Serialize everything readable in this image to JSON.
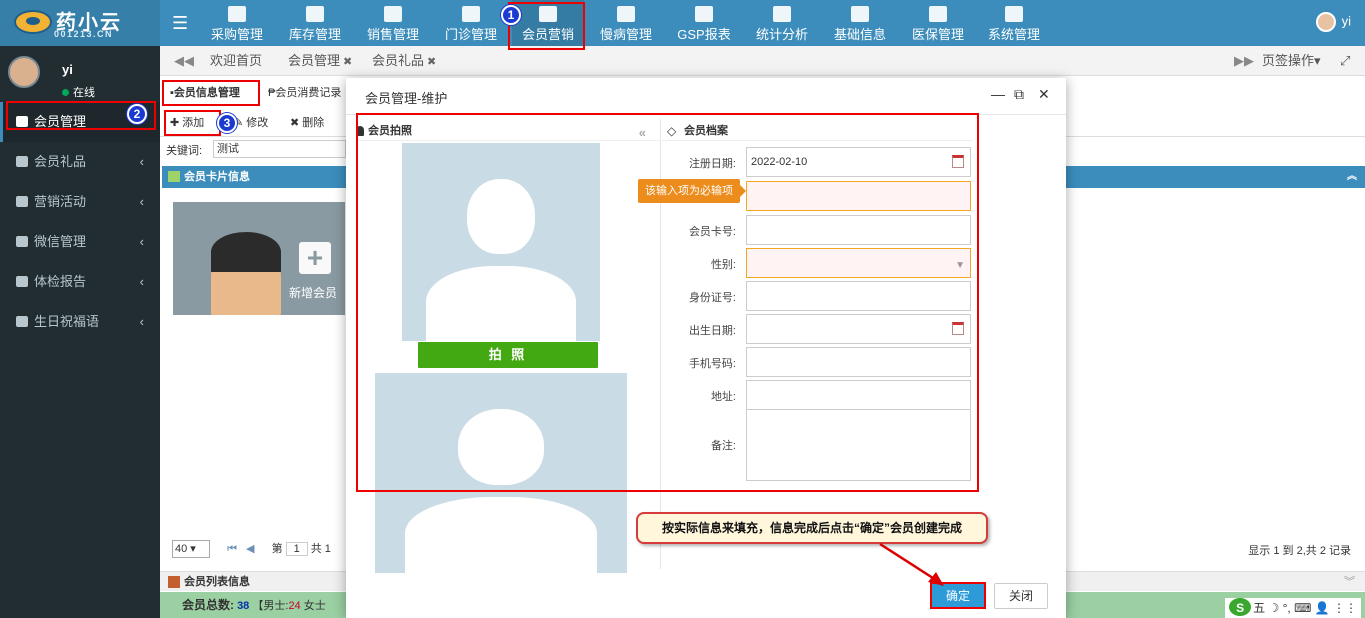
{
  "logo": {
    "main": "药小云",
    "sub": "001213.CN"
  },
  "topnav": [
    {
      "label": "采购管理",
      "icon": "cart-icon"
    },
    {
      "label": "库存管理",
      "icon": "cube-icon"
    },
    {
      "label": "销售管理",
      "icon": "register-icon"
    },
    {
      "label": "门诊管理",
      "icon": "medkit-icon"
    },
    {
      "label": "会员营销",
      "icon": "users-icon"
    },
    {
      "label": "慢病管理",
      "icon": "hospital-icon"
    },
    {
      "label": "GSP报表",
      "icon": "report-icon"
    },
    {
      "label": "统计分析",
      "icon": "chart-icon"
    },
    {
      "label": "基础信息",
      "icon": "book-icon"
    },
    {
      "label": "医保管理",
      "icon": "windows-icon"
    },
    {
      "label": "系统管理",
      "icon": "windows-icon"
    }
  ],
  "user": {
    "name": "yi",
    "status": "在线"
  },
  "sidebar": [
    {
      "label": "会员管理"
    },
    {
      "label": "会员礼品"
    },
    {
      "label": "营销活动"
    },
    {
      "label": "微信管理"
    },
    {
      "label": "体检报告"
    },
    {
      "label": "生日祝福语"
    }
  ],
  "tabs": [
    {
      "label": "欢迎首页"
    },
    {
      "label": "会员管理"
    },
    {
      "label": "会员礼品"
    }
  ],
  "tab_actions": {
    "label": "页签操作▾"
  },
  "subtabs": [
    {
      "label": "会员信息管理"
    },
    {
      "label": "会员消费记录"
    }
  ],
  "toolbar": {
    "add": "添加",
    "edit": "修改",
    "delete": "删除"
  },
  "keyword": {
    "label": "关键词:",
    "value": "测试"
  },
  "card_section": {
    "title": "会员卡片信息",
    "add_member": "新增会员"
  },
  "pager": {
    "page_size": "40",
    "page_label_prefix": "第",
    "page": "1",
    "page_label_suffix": "共 1",
    "info": "显示 1 到 2,共 2 记录"
  },
  "list_section": {
    "title": "会员列表信息"
  },
  "summary": {
    "label": "会员总数:",
    "total": "38",
    "male_label": "【男士:",
    "male": "24",
    "female_label": "女士"
  },
  "ime": {
    "text": "五 ☽ °, ⌨ 👤 ⋮⋮"
  },
  "modal": {
    "title": "会员管理-维护",
    "photo_section": "会员拍照",
    "shoot_button": "拍 照",
    "file_section": "会员档案",
    "fields": [
      {
        "label": "注册日期:",
        "value": "2022-02-10",
        "calendar": true,
        "required": false
      },
      {
        "label": "",
        "value": "",
        "required": true
      },
      {
        "label": "会员卡号:",
        "value": "",
        "required": false
      },
      {
        "label": "性别:",
        "value": "",
        "required": true,
        "select": true
      },
      {
        "label": "身份证号:",
        "value": "",
        "required": false
      },
      {
        "label": "出生日期:",
        "value": "",
        "calendar": true,
        "required": false
      },
      {
        "label": "手机号码:",
        "value": "",
        "required": false
      },
      {
        "label": "地址:",
        "value": "",
        "required": false
      }
    ],
    "remark_label": "备注:",
    "tooltip": "该输入项为必输项",
    "ok": "确定",
    "close": "关闭"
  },
  "annotations": {
    "badge1": "1",
    "badge2": "2",
    "badge3": "3",
    "hint": "按实际信息来填充，信息完成后点击“确定”会员创建完成"
  },
  "colors": {
    "topbar": "#3c8dbc",
    "sidebar": "#222d32",
    "accent_green": "#43a913",
    "ok_blue": "#2e9bd9",
    "annotation_red": "#e00000"
  }
}
